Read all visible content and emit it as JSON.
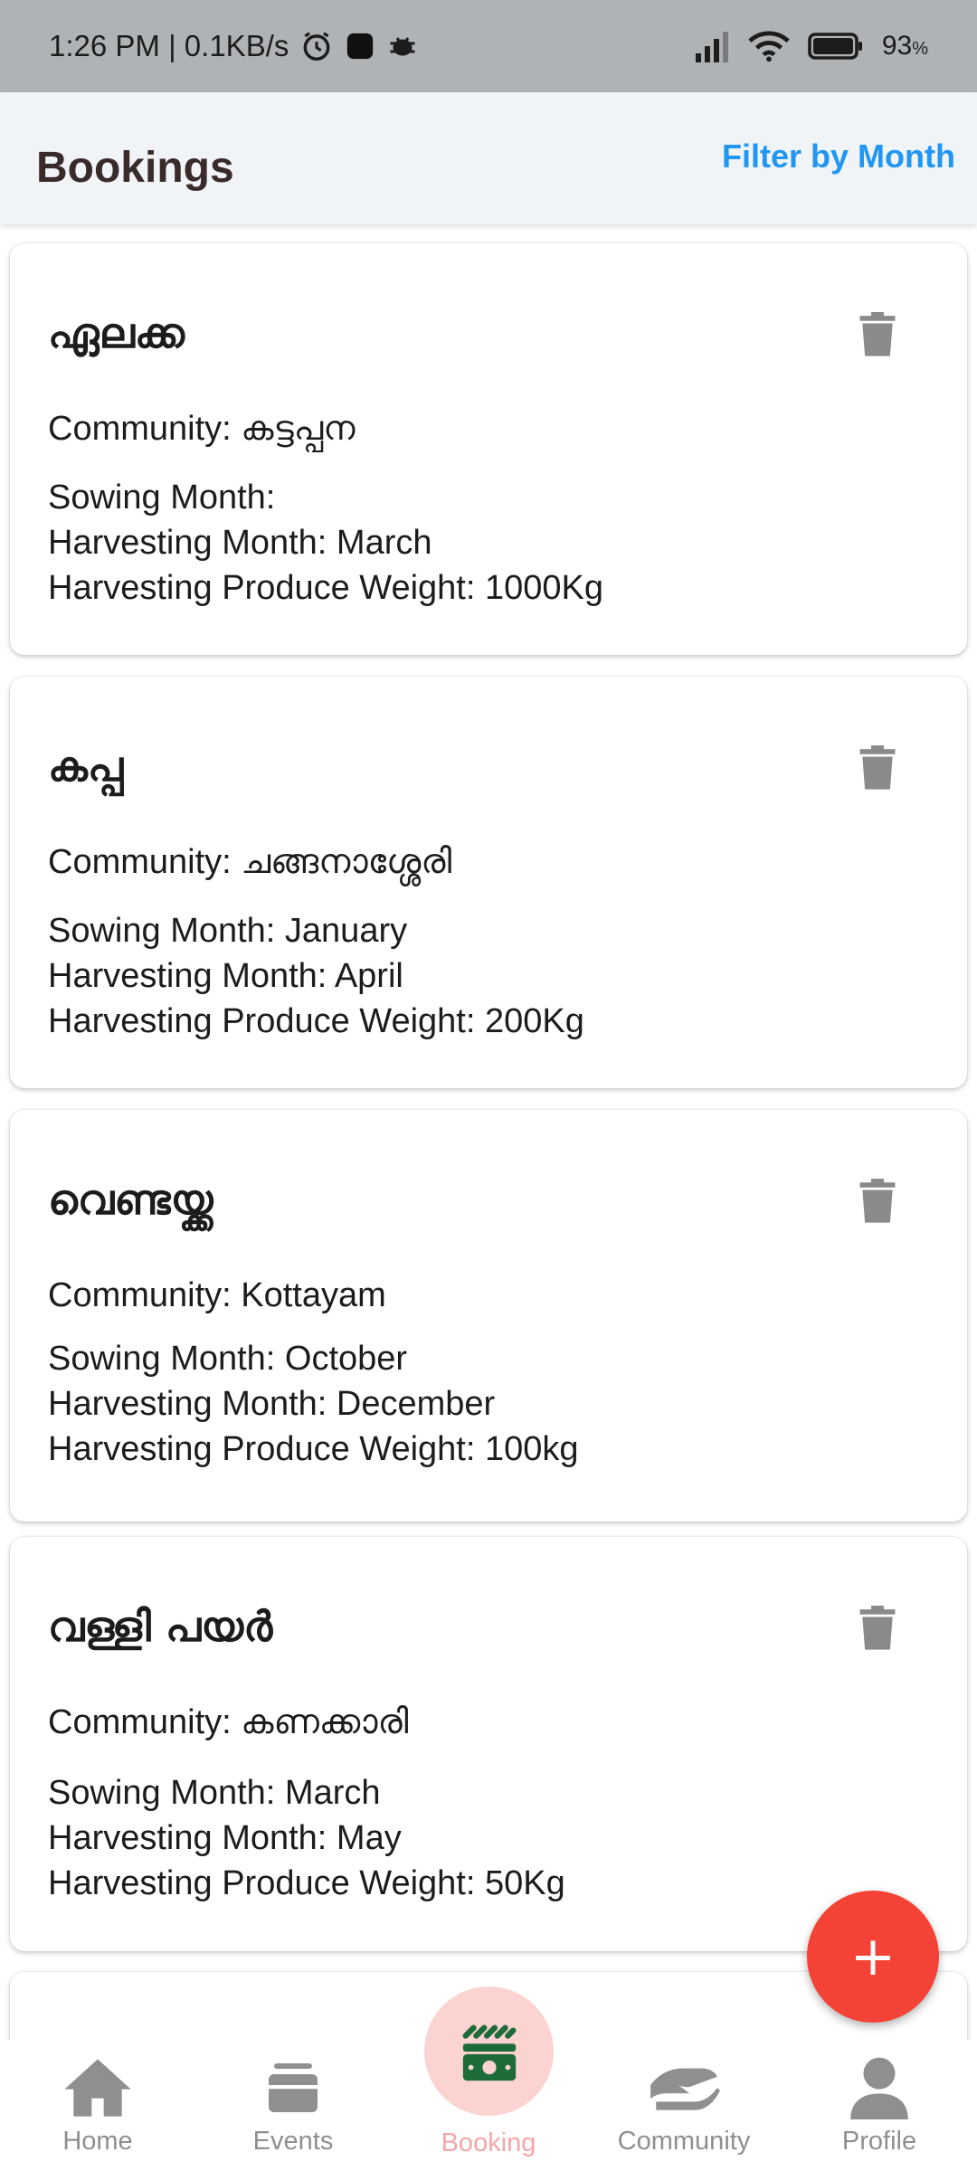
{
  "status_bar": {
    "time_info": "1:26 PM | 0.1KB/s",
    "battery": "93",
    "battery_unit": "%",
    "icons": [
      "alarm-icon",
      "app-square-icon",
      "bug-icon",
      "signal-icon",
      "wifi-icon",
      "battery-icon"
    ]
  },
  "header": {
    "title": "Bookings",
    "filter_label": "Filter by Month"
  },
  "bookings": [
    {
      "title": "ഏലക്ക",
      "community": "Community: കട്ടപ്പന",
      "sowing": "Sowing Month: ",
      "harvesting": "Harvesting Month: March",
      "weight": "Harvesting Produce Weight: 1000Kg"
    },
    {
      "title": "കപ്പ",
      "community": "Community: ചങ്ങനാശ്ശേരി",
      "sowing": "Sowing Month: January",
      "harvesting": "Harvesting Month: April",
      "weight": "Harvesting Produce Weight: 200Kg"
    },
    {
      "title": "വെണ്ടയ്ക്ക",
      "community": "Community: Kottayam",
      "sowing": "Sowing Month: October",
      "harvesting": "Harvesting Month: December",
      "weight": "Harvesting Produce Weight: 100kg"
    },
    {
      "title": " വള്ളി പയർ",
      "community": "Community: കണക്കാരി",
      "sowing": "Sowing Month: March",
      "harvesting": "Harvesting Month: May",
      "weight": "Harvesting Produce Weight: 50Kg"
    }
  ],
  "fab": {
    "label": "+"
  },
  "nav": {
    "items": [
      {
        "label": "Home",
        "icon": "home-icon"
      },
      {
        "label": "Events",
        "icon": "events-icon"
      },
      {
        "label": "Booking",
        "icon": "money-icon"
      },
      {
        "label": "Community",
        "icon": "handshake-icon"
      },
      {
        "label": "Profile",
        "icon": "person-icon"
      }
    ],
    "active": "Booking"
  },
  "colors": {
    "accent_blue": "#2196f3",
    "fab_red": "#f44336",
    "active_bubble": "#fbd3d0",
    "active_icon": "#1e6b3a",
    "inactive_icon": "#8f8f8f"
  }
}
